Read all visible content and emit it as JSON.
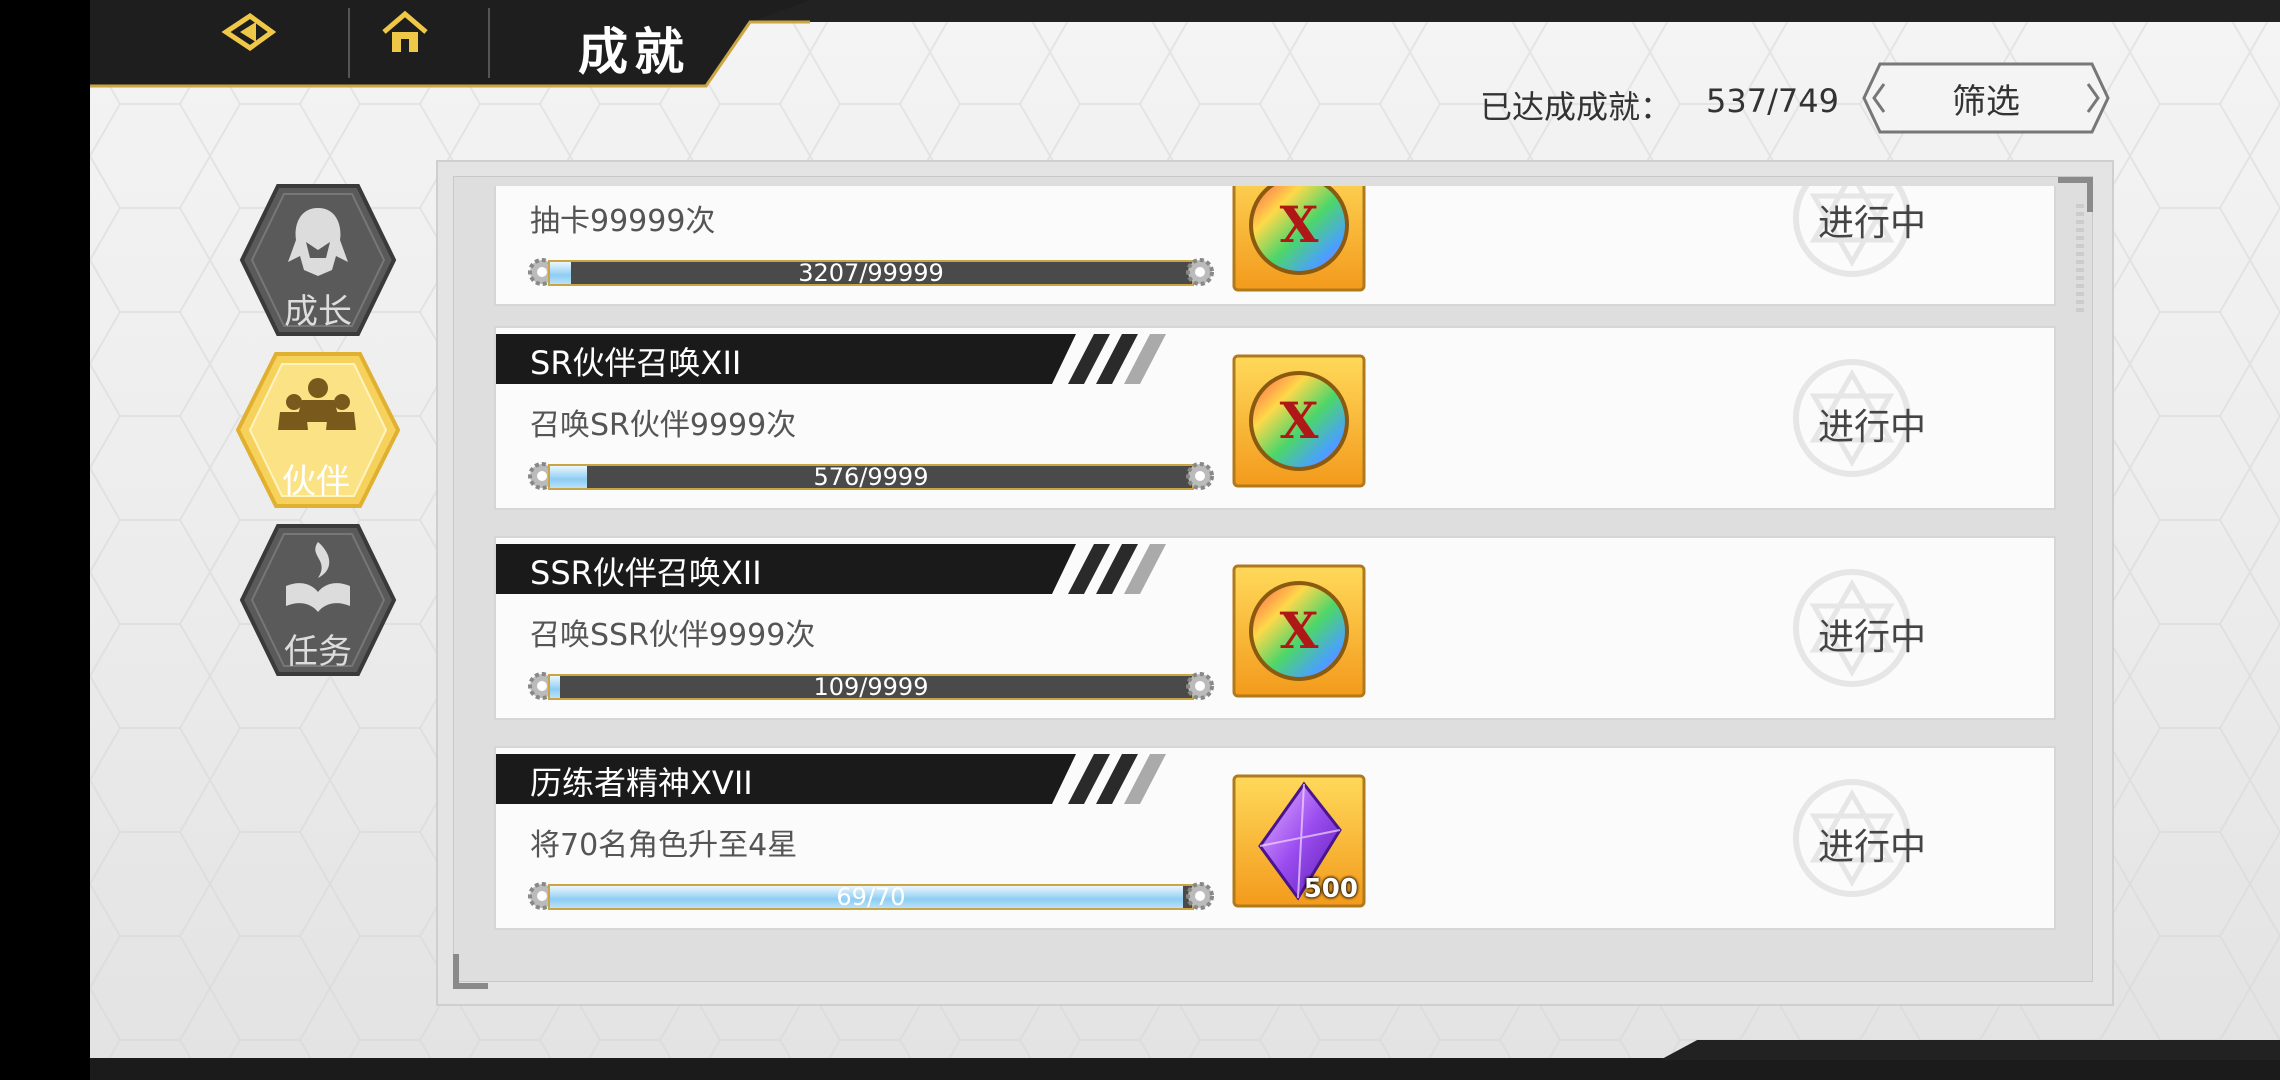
{
  "header": {
    "title": "成就",
    "back_icon": "back-arrow-icon",
    "home_icon": "home-icon"
  },
  "summary": {
    "label": "已达成成就：",
    "value": "537/749"
  },
  "filter": {
    "label": "筛选"
  },
  "tabs": [
    {
      "label": "成长",
      "icon": "hooded-figure-icon",
      "active": false
    },
    {
      "label": "伙伴",
      "icon": "group-icon",
      "active": true
    },
    {
      "label": "任务",
      "icon": "flame-book-icon",
      "active": false
    }
  ],
  "achievements": [
    {
      "title": "",
      "desc": "抽卡99999次",
      "progress": "3207/99999",
      "fraction": 0.032,
      "reward": "rainbow-x-coin",
      "status": "进行中"
    },
    {
      "title": "SR伙伴召唤XII",
      "desc": "召唤SR伙伴9999次",
      "progress": "576/9999",
      "fraction": 0.058,
      "reward": "rainbow-x-coin",
      "status": "进行中"
    },
    {
      "title": "SSR伙伴召唤XII",
      "desc": "召唤SSR伙伴9999次",
      "progress": "109/9999",
      "fraction": 0.011,
      "reward": "rainbow-x-coin",
      "status": "进行中"
    },
    {
      "title": "历练者精神XVII",
      "desc": "将70名角色升至4星",
      "progress": "69/70",
      "fraction": 0.986,
      "reward": "purple-crystal",
      "reward_count": "500",
      "status": "进行中"
    }
  ],
  "colors": {
    "accent_gold": "#f0c848",
    "dark_header": "#1e1e1e",
    "bar_fill": "#8ecdf2"
  }
}
